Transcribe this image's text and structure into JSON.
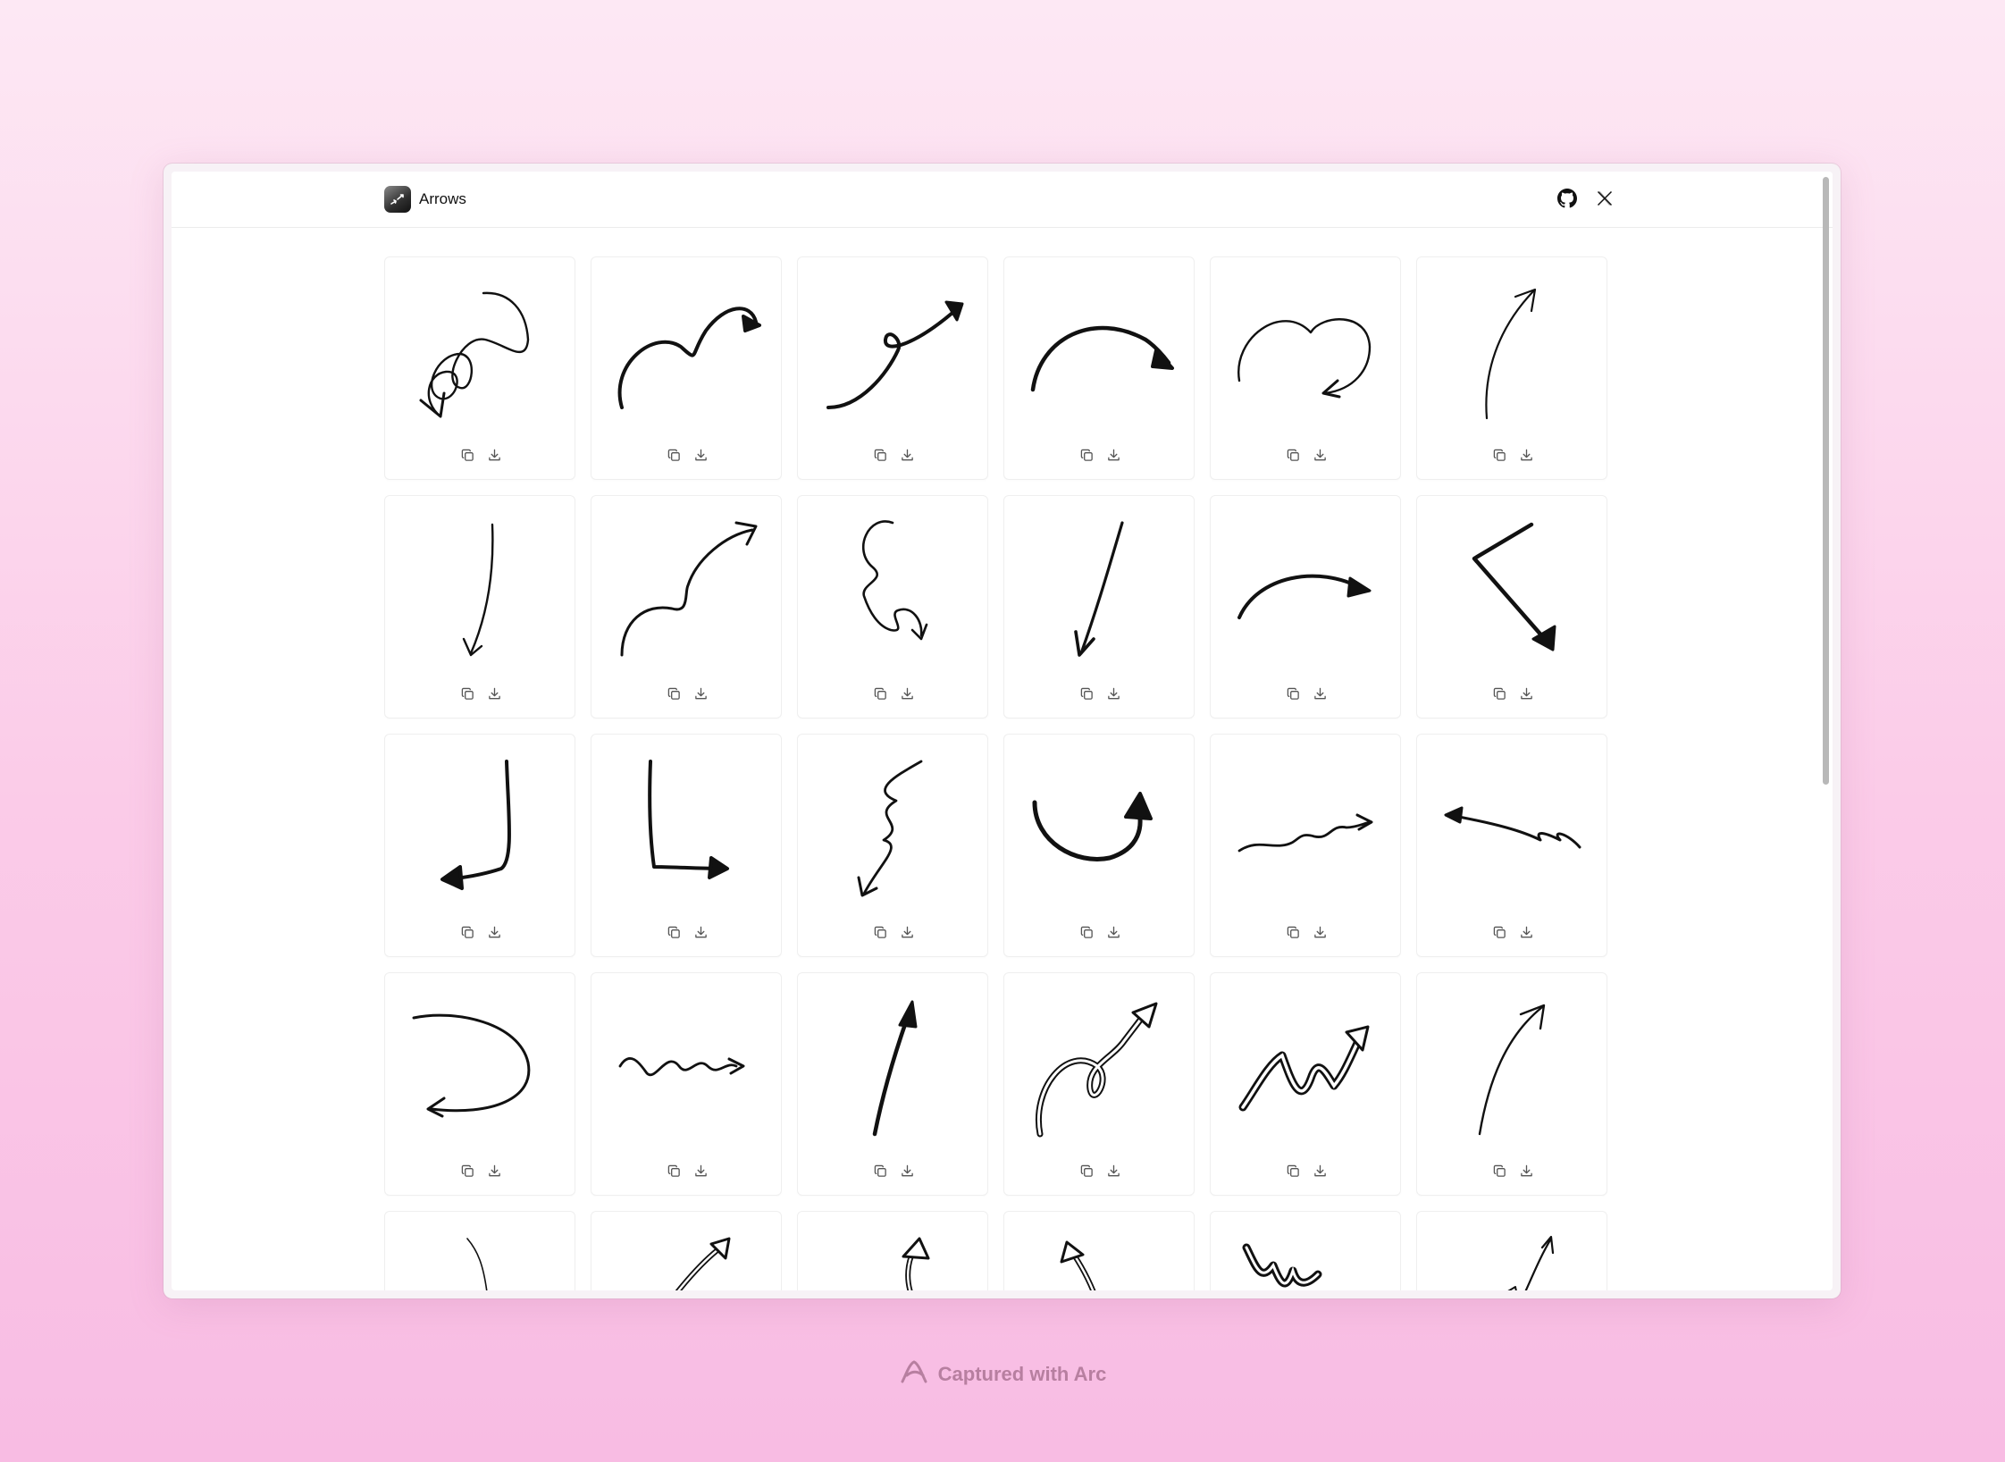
{
  "header": {
    "title": "Arrows"
  },
  "social": [
    {
      "icon": "github-icon"
    },
    {
      "icon": "x-icon"
    }
  ],
  "card_actions": {
    "copy_icon": "copy-icon",
    "download_icon": "download-icon"
  },
  "arrows": [
    {
      "icon": "loop-spiral-arrow-icon"
    },
    {
      "icon": "wavy-curve-arrow-icon"
    },
    {
      "icon": "loop-up-arrow-icon"
    },
    {
      "icon": "arc-right-arrow-icon"
    },
    {
      "icon": "double-hump-arrow-icon"
    },
    {
      "icon": "thin-up-arrow-icon"
    },
    {
      "icon": "thin-down-arrow-icon"
    },
    {
      "icon": "loop-up-right-arrow-icon"
    },
    {
      "icon": "squiggle-down-arrow-icon"
    },
    {
      "icon": "straight-down-arrow-icon"
    },
    {
      "icon": "arc-right-short-arrow-icon"
    },
    {
      "icon": "angle-down-right-arrow-icon"
    },
    {
      "icon": "corner-left-arrow-icon"
    },
    {
      "icon": "corner-right-arrow-icon"
    },
    {
      "icon": "zigzag-down-arrow-icon"
    },
    {
      "icon": "u-turn-up-arrow-icon"
    },
    {
      "icon": "wave-right-arrow-icon"
    },
    {
      "icon": "zigzag-left-arrow-icon"
    },
    {
      "icon": "loop-back-left-arrow-icon"
    },
    {
      "icon": "wave-small-right-arrow-icon"
    },
    {
      "icon": "bold-up-arrow-icon"
    },
    {
      "icon": "outlined-loop-arrow-icon"
    },
    {
      "icon": "outlined-zigzag-arrow-icon"
    },
    {
      "icon": "curve-up-right-arrow-icon"
    },
    {
      "icon": "thin-curve-arrow-icon"
    },
    {
      "icon": "outlined-up-right-arrow-icon"
    },
    {
      "icon": "outlined-up-arrow-icon"
    },
    {
      "icon": "outlined-up-left-arrow-icon"
    },
    {
      "icon": "outlined-zigzag-bold-arrow-icon"
    },
    {
      "icon": "double-up-arrow-icon"
    }
  ],
  "footer": {
    "text": "Captured with Arc",
    "icon": "arc-logo-icon"
  },
  "colors": {
    "background_top": "#fde8f4",
    "background_bottom": "#f8bce3",
    "footer_text": "#b77fa0",
    "ink": "#111111"
  }
}
